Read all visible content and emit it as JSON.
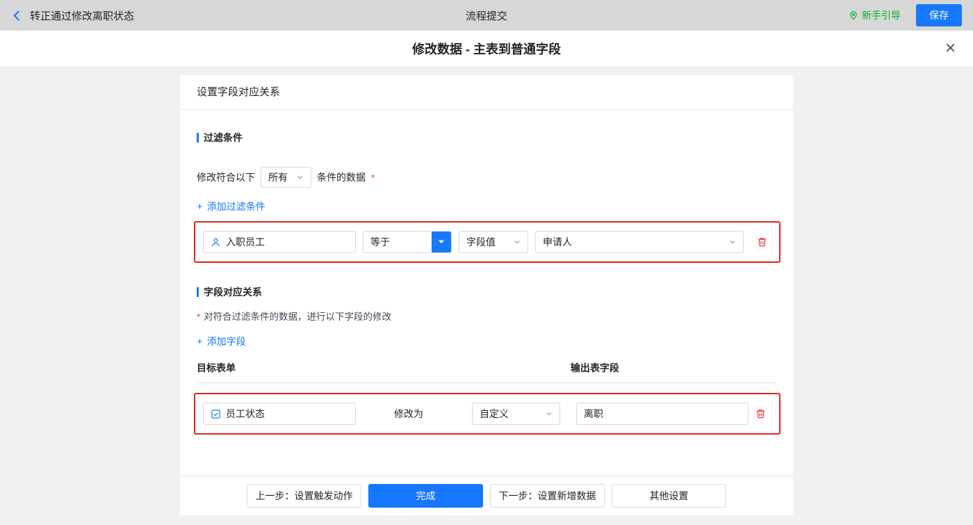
{
  "topbar": {
    "title": "转正通过修改离职状态",
    "center_title": "流程提交",
    "guide_label": "新手引导",
    "save_label": "保存"
  },
  "modal": {
    "title": "修改数据 - 主表到普通字段",
    "close_icon": "✕"
  },
  "card": {
    "header": "设置字段对应关系",
    "filter_section": {
      "title": "过滤条件",
      "prefix": "修改符合以下",
      "match_select": "所有",
      "suffix": "条件的数据",
      "required_mark": "*",
      "add_plus": "+",
      "add_label": "添加过滤条件",
      "row": {
        "field": "入职员工",
        "operator": "等于",
        "value_type": "字段值",
        "value": "申请人"
      }
    },
    "mapping_section": {
      "title": "字段对应关系",
      "required_mark": "*",
      "description": "对符合过滤条件的数据，进行以下字段的修改",
      "add_plus": "+",
      "add_label": "添加字段",
      "col_target": "目标表单",
      "col_output": "输出表字段",
      "row": {
        "field": "员工状态",
        "action_label": "修改为",
        "mode_select": "自定义",
        "value": "离职"
      }
    },
    "footer": {
      "prev_label": "上一步：设置触发动作",
      "done_label": "完成",
      "next_label": "下一步：设置新增数据",
      "other_label": "其他设置"
    }
  },
  "colors": {
    "accent_blue": "#1677ff",
    "highlight_red": "#e2231a",
    "danger_red": "#f5222d",
    "guide_green": "#00b42a"
  }
}
